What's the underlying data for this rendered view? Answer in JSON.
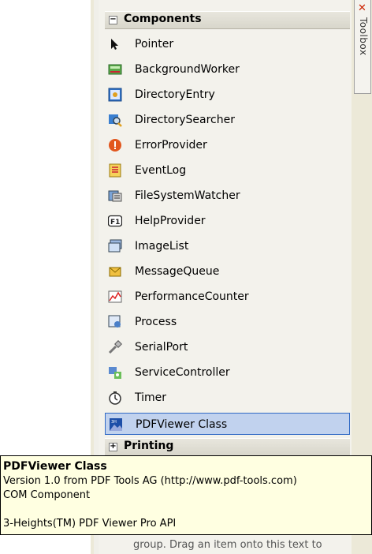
{
  "toolbox_tab": {
    "close_glyph": "✕",
    "label": "Toolbox"
  },
  "categories": [
    {
      "toggle": "−",
      "label": "Components"
    },
    {
      "toggle": "+",
      "label": "Printing"
    }
  ],
  "items": [
    {
      "label": "Pointer",
      "icon": "pointer-icon"
    },
    {
      "label": "BackgroundWorker",
      "icon": "backgroundworker-icon"
    },
    {
      "label": "DirectoryEntry",
      "icon": "directoryentry-icon"
    },
    {
      "label": "DirectorySearcher",
      "icon": "directorysearcher-icon"
    },
    {
      "label": "ErrorProvider",
      "icon": "errorprovider-icon"
    },
    {
      "label": "EventLog",
      "icon": "eventlog-icon"
    },
    {
      "label": "FileSystemWatcher",
      "icon": "filesystemwatcher-icon"
    },
    {
      "label": "HelpProvider",
      "icon": "helpprovider-icon"
    },
    {
      "label": "ImageList",
      "icon": "imagelist-icon"
    },
    {
      "label": "MessageQueue",
      "icon": "messagequeue-icon"
    },
    {
      "label": "PerformanceCounter",
      "icon": "performancecounter-icon"
    },
    {
      "label": "Process",
      "icon": "process-icon"
    },
    {
      "label": "SerialPort",
      "icon": "serialport-icon"
    },
    {
      "label": "ServiceController",
      "icon": "servicecontroller-icon"
    },
    {
      "label": "Timer",
      "icon": "timer-icon"
    },
    {
      "label": "PDFViewer Class",
      "icon": "pdfviewer-icon",
      "selected": true
    }
  ],
  "tooltip": {
    "title": "PDFViewer Class",
    "version": "Version 1.0 from PDF Tools AG (http://www.pdf-tools.com)",
    "type": "COM Component",
    "description": "3-Heights(TM) PDF Viewer Pro API"
  },
  "hidden_text": "group. Drag an item onto this text to"
}
